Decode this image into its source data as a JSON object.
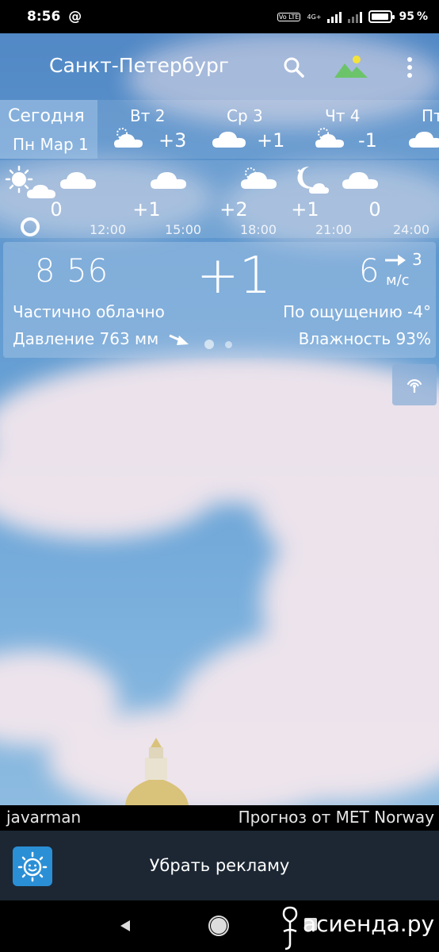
{
  "status_bar": {
    "time": "8:56",
    "at_symbol": "@",
    "volte": "Vo LTE",
    "network": "4G+",
    "battery_percent": "95",
    "battery_level": 0.95
  },
  "header": {
    "city": "Санкт-Петербург",
    "icons": {
      "search": "search-icon",
      "wallpaper": "landscape-icon",
      "menu": "more-vert-icon"
    }
  },
  "days": [
    {
      "name": "Сегодня",
      "date": "Пн Мар 1",
      "active": true
    },
    {
      "name": "Вт 2",
      "temp": "+3",
      "icon": "partly-cloudy-icon"
    },
    {
      "name": "Ср 3",
      "temp": "+1",
      "icon": "cloud-icon"
    },
    {
      "name": "Чт 4",
      "temp": "-1",
      "icon": "partly-cloudy-icon"
    },
    {
      "name": "Пт",
      "icon": "cloud-icon"
    }
  ],
  "hours": {
    "temps": [
      "0",
      "+1",
      "+2",
      "+1",
      "0"
    ],
    "times": [
      "12:00",
      "15:00",
      "18:00",
      "21:00",
      "24:00"
    ],
    "icons": [
      "sun-cloud-icon",
      "cloud-icon",
      "cloud-icon",
      "partly-cloudy-icon",
      "moon-cloud-icon",
      "cloud-icon"
    ]
  },
  "current": {
    "time": "8 56",
    "temp": "+1",
    "wind_speed": "6",
    "wind_gust": "3",
    "wind_unit": "м/с",
    "condition": "Частично облачно",
    "feels_like": "По ощущению -4°",
    "pressure": "Давление 763 мм",
    "humidity": "Влажность 93%"
  },
  "credit": {
    "user": "javarman",
    "source": "Прогноз от MET Norway"
  },
  "ad": {
    "label": "Убрать рекламу"
  },
  "watermark": "асиенда.ру"
}
